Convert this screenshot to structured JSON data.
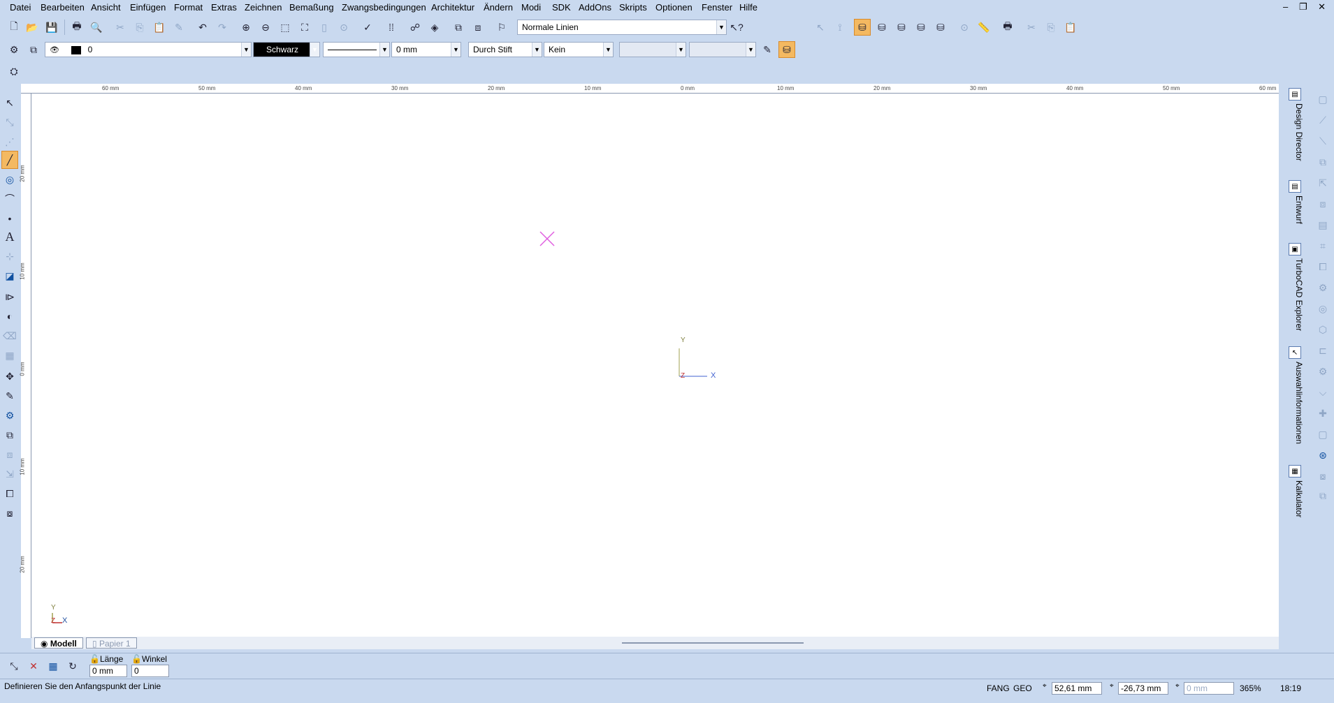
{
  "menu": {
    "items": [
      "Datei",
      "Bearbeiten",
      "Ansicht",
      "Einfügen",
      "Format",
      "Extras",
      "Zeichnen",
      "Bemaßung",
      "Zwangsbedingungen",
      "Architektur",
      "Ändern",
      "Modi",
      "SDK",
      "AddOns",
      "Skripts",
      "Optionen",
      "Fenster",
      "Hilfe"
    ],
    "window_controls": "‒ ❐ ✕"
  },
  "toolbar1": {
    "line_style_value": "Normale Linien"
  },
  "property_bar": {
    "layer_value": "0",
    "color_value": "Schwarz",
    "width_value": "0 mm",
    "pen_value": "Durch Stift",
    "fill_value": "Kein",
    "empty1": "",
    "empty2": ""
  },
  "rulers": {
    "top_labels": [
      "60 mm",
      "50 mm",
      "40 mm",
      "30 mm",
      "20 mm",
      "10 mm",
      "0 mm",
      "10 mm",
      "20 mm",
      "30 mm",
      "40 mm",
      "50 mm",
      "60 mm"
    ],
    "left_labels": [
      "20 mm",
      "10 mm",
      "0 mm",
      "10 mm",
      "20 mm"
    ]
  },
  "canvas": {
    "axis_y": "Y",
    "axis_x": "X",
    "axis_z": "Z",
    "ucs_y": "Y",
    "ucs_z": "Z",
    "ucs_x": "X"
  },
  "right_tabs": [
    "Design Director",
    "Entwurf",
    "TurboCAD Explorer",
    "Auswahlinformationen",
    "Kalkulator"
  ],
  "layout_tabs": [
    "Modell",
    "Papier 1"
  ],
  "inspector": {
    "length_label": "Länge",
    "length_value": "0 mm",
    "angle_label": "Winkel",
    "angle_value": "0"
  },
  "status": {
    "prompt": "Definieren Sie den Anfangspunkt der Linie",
    "fang": "FANG",
    "geo": "GEO",
    "x_value": "52,61 mm",
    "y_value": "-26,73 mm",
    "z_value": "0 mm",
    "zoom": "365%",
    "time": "18:19"
  },
  "colors": {
    "accent_active": "#f4b961",
    "background": "#c9d9ef",
    "cursor_marker": "#e060e0"
  }
}
